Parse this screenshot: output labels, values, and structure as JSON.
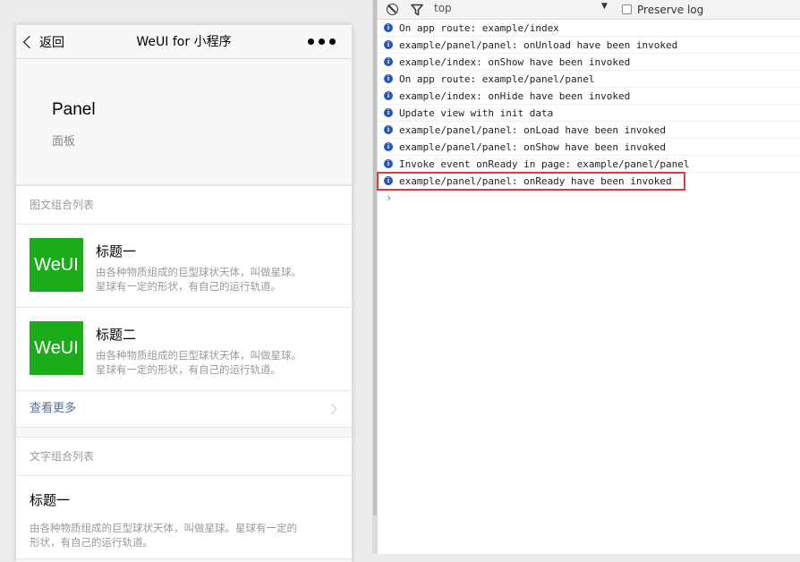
{
  "navbar": {
    "back_label": "返回",
    "title": "WeUI for 小程序"
  },
  "page_header": {
    "title": "Panel",
    "desc": "面板"
  },
  "panel_media": {
    "header": "图文组合列表",
    "items": [
      {
        "thumb_text": "WeUI",
        "title": "标题一",
        "desc_line1": "由各种物质组成的巨型球状天体，叫做星球。",
        "desc_line2": "星球有一定的形状，有自己的运行轨道。"
      },
      {
        "thumb_text": "WeUI",
        "title": "标题二",
        "desc_line1": "由各种物质组成的巨型球状天体，叫做星球。",
        "desc_line2": "星球有一定的形状，有自己的运行轨道。"
      }
    ],
    "footer": "查看更多"
  },
  "panel_text": {
    "header": "文字组合列表",
    "items": [
      {
        "title": "标题一",
        "desc_line1": "由各种物质组成的巨型球状天体，叫做星球。星球有一定的",
        "desc_line2": "形状，有自己的运行轨道。"
      }
    ]
  },
  "console": {
    "toolbar": {
      "context": "top",
      "preserve_log": "Preserve log"
    },
    "logs": [
      "On app route: example/index",
      "example/panel/panel: onUnload have been invoked",
      "example/index: onShow have been invoked",
      "On app route: example/panel/panel",
      "example/index: onHide have been invoked",
      "Update view with init data",
      "example/panel/panel: onLoad have been invoked",
      "example/panel/panel: onShow have been invoked",
      "Invoke event onReady in page: example/panel/panel",
      "example/panel/panel: onReady have been invoked"
    ],
    "prompt": "›"
  },
  "colors": {
    "weui_green": "#1aad19",
    "link_blue": "#586c94",
    "info_icon": "#2754bf",
    "highlight_border": "#e0393e"
  }
}
